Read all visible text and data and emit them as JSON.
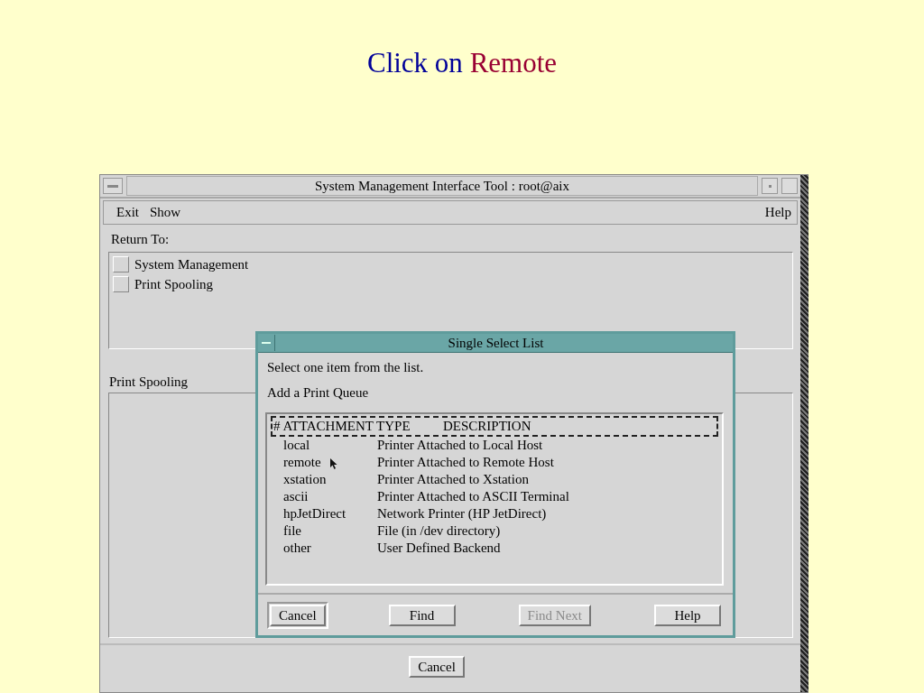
{
  "slide_title": {
    "lead": "Click on",
    "emphasis": "Remote"
  },
  "window": {
    "title": "System Management Interface Tool : root@aix",
    "menus_left": [
      "Exit",
      "Show"
    ],
    "menus_right": [
      "Help"
    ],
    "return_to": {
      "label": "Return To:",
      "items": [
        "System Management",
        "Print Spooling"
      ]
    },
    "section": {
      "label": "Print Spooling"
    },
    "buttons": [
      {
        "label": "Cancel"
      }
    ]
  },
  "dialog": {
    "title": "Single Select List",
    "instruction": "Select one item from the list.",
    "subtitle": "Add a Print Queue",
    "header": {
      "column_1": "# ATTACHMENT TYPE",
      "column_2": "DESCRIPTION",
      "focused": true
    },
    "rows": [
      {
        "type": "local",
        "description": "Printer Attached to Local Host",
        "pointer": false
      },
      {
        "type": "remote",
        "description": "Printer Attached to Remote Host",
        "pointer": true
      },
      {
        "type": "xstation",
        "description": "Printer Attached to Xstation",
        "pointer": false
      },
      {
        "type": "ascii",
        "description": "Printer Attached to ASCII Terminal",
        "pointer": false
      },
      {
        "type": "hpJetDirect",
        "description": "Network Printer (HP JetDirect)",
        "pointer": false
      },
      {
        "type": "file",
        "description": "File (in /dev directory)",
        "pointer": false
      },
      {
        "type": "other",
        "description": "User Defined Backend",
        "pointer": false
      }
    ],
    "buttons": [
      {
        "label": "Cancel",
        "default": true,
        "disabled": false
      },
      {
        "label": "Find",
        "default": false,
        "disabled": false
      },
      {
        "label": "Find Next",
        "default": false,
        "disabled": true
      },
      {
        "label": "Help",
        "default": false,
        "disabled": false
      }
    ]
  }
}
